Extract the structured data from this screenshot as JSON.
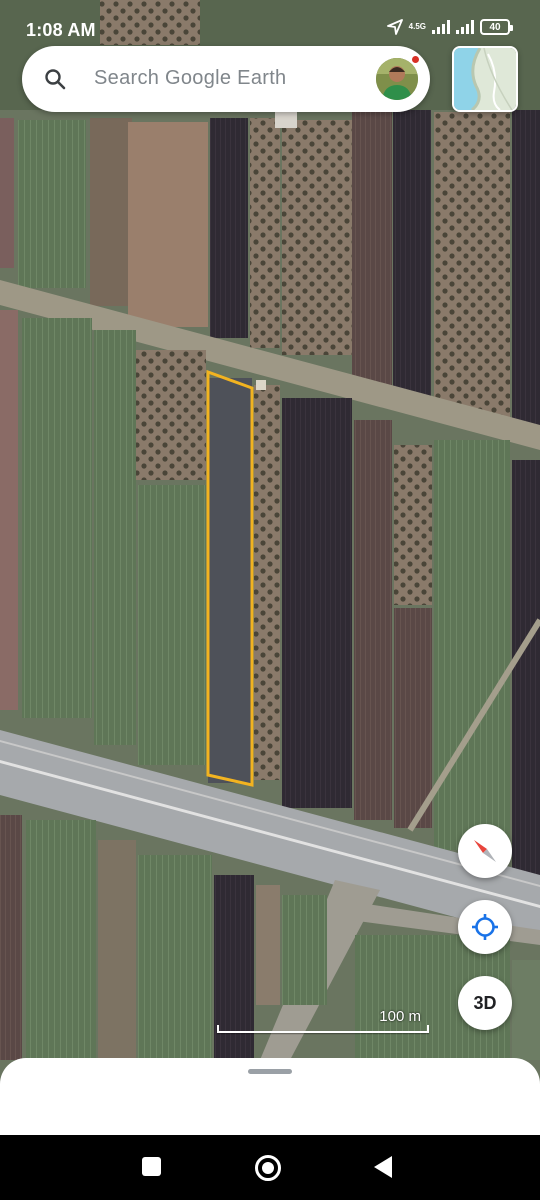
{
  "status_bar": {
    "time": "1:08 AM",
    "network_type": "4.5G",
    "battery_level": "40",
    "icons": [
      "location-arrow-icon",
      "signal-icon",
      "signal-icon",
      "battery-icon"
    ]
  },
  "search": {
    "placeholder": "Search Google Earth",
    "icon": "search-icon",
    "has_notification": true
  },
  "map": {
    "scale_label": "100 m",
    "highlight_color": "#f2b320"
  },
  "controls": {
    "compass_icon": "compass-icon",
    "location_icon": "my-location-icon",
    "view_toggle_label": "3D"
  },
  "nav_bar": {
    "icons": [
      "recent-apps-icon",
      "home-icon",
      "back-icon"
    ]
  }
}
